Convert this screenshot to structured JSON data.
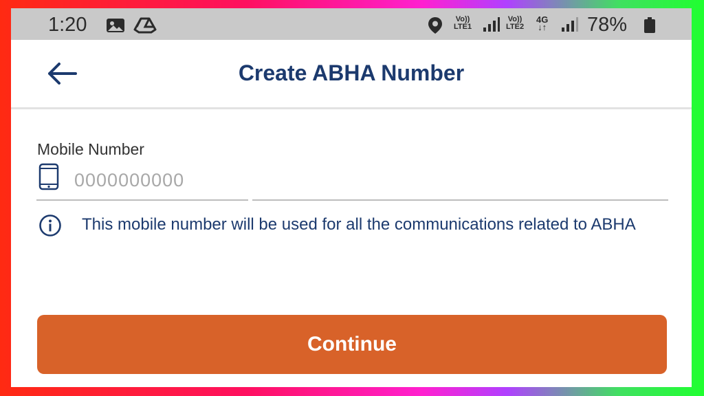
{
  "status_bar": {
    "time": "1:20",
    "sim1_label": "Vo))",
    "sim1_net": "LTE1",
    "sim2_label": "Vo))",
    "sim2_net": "LTE2",
    "data_type": "4G",
    "battery": "78%",
    "icons": [
      "image-icon",
      "drive-icon",
      "location-icon",
      "signal-icon",
      "battery-icon"
    ]
  },
  "header": {
    "title": "Create ABHA Number",
    "back_icon": "back-arrow-icon"
  },
  "form": {
    "mobile_label": "Mobile Number",
    "mobile_placeholder": "0000000000",
    "mobile_value": "",
    "info_text": "This mobile number will be used for all the communications related to ABHA",
    "continue_label": "Continue"
  },
  "colors": {
    "primary_text": "#1c3a6e",
    "button": "#d86229",
    "status_bar": "#c9c9c9"
  }
}
